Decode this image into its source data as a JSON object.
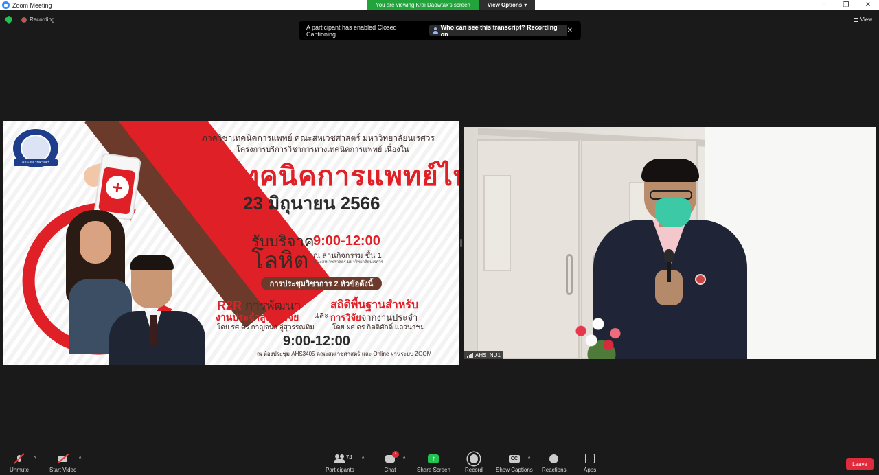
{
  "window": {
    "title": "Zoom Meeting",
    "controls": [
      "–",
      "❐",
      "✕"
    ]
  },
  "banner": {
    "viewing": "You are viewing Krai Daowtak's screen",
    "view_options": "View Options",
    "view_options_caret": "▾"
  },
  "top": {
    "recording": "Recording",
    "view": "View"
  },
  "toast": {
    "message": "A participant has enabled Closed Captioning",
    "link": "Who can see this transcript? Recording on",
    "close": "✕"
  },
  "poster": {
    "logo_ribbon": "คณะสหเวชศาสตร์",
    "dept": "ภาควิชาเทคนิคการแพทย์ คณะสหเวชศาสตร์ มหาวิทยาลัยนเรศวร",
    "project": "โครงการบริการวิชาการทางเทคนิคการแพทย์ เนื่องใน",
    "day": "วันเทคนิคการแพทย์ไทย",
    "date": "23 มิถุนายน 2566",
    "donate": "รับบริจาค",
    "blood": "โลหิต",
    "time1": "9:00-12:00",
    "location": "ณ ลานกิจกรรม ชั้น 1",
    "location_sub": "คณะสหเวชศาสตร์ มหาวิทยาลัยนเรศวร",
    "pill": "การประชุมวิชาการ 2 หัวข้อดังนี้",
    "r2r_prefix": "R2R",
    "r2r_rest": " การพัฒนา",
    "r2r_line2": "งานประจำสู่งานวิจัย",
    "by1": "โดย รศ.ดร.กาญจนา อู่สุวรรณทิม",
    "and": "และ",
    "stat_line1": "สถิติพื้นฐานสำหรับ",
    "stat_research": "การวิจัย",
    "stat_rest": "จากงานประจำ",
    "by2": "โดย ผศ.ดร.กิตติศักดิ์ แถวนาชม",
    "time2": "9:00-12:00",
    "room": "ณ ห้องประชุม AHS3405 คณะสหเวชศาสตร์ และ Online ผ่านระบบ ZOOM",
    "cross": "+"
  },
  "video": {
    "name": "AHS_NU1"
  },
  "toolbar": {
    "unmute": "Unmute",
    "start_video": "Start Video",
    "participants": "Participants",
    "participants_count": "74",
    "chat": "Chat",
    "chat_badge": "4",
    "share_screen": "Share Screen",
    "record": "Record",
    "show_captions": "Show Captions",
    "reactions": "Reactions",
    "apps": "Apps",
    "leave": "Leave",
    "caret": "^"
  },
  "colors": {
    "share_green": "#23c151",
    "leave_red": "#e02b3c",
    "banner_green": "#22a33c",
    "zoom_blue": "#2d8cff"
  }
}
